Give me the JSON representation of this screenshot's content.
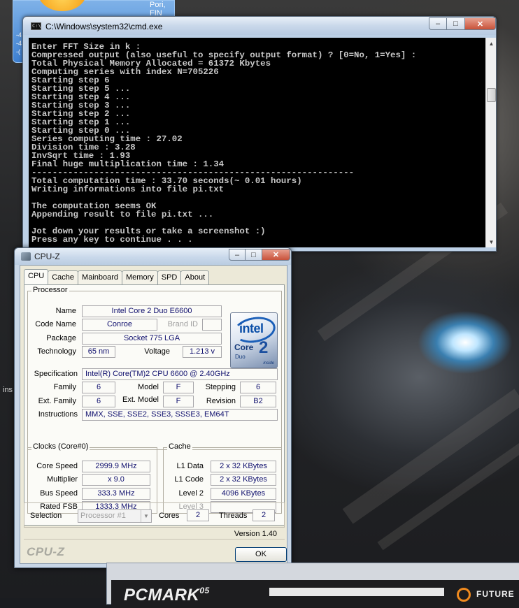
{
  "desktop": {
    "gadget_city": "Pori, FIN",
    "gadget_small": [
      "-4",
      "-4",
      "-("
    ],
    "side_text": "ins"
  },
  "cmd": {
    "title": "C:\\Windows\\system32\\cmd.exe",
    "icon_text": "C:\\",
    "lines": [
      "Enter FFT Size in k :",
      "Compressed output (also useful to specify output format) ? [0=No, 1=Yes] :",
      "Total Physical Memory Allocated = 61372 Kbytes",
      "Computing series with index N=705226",
      "Starting step 6",
      "Starting step 5 ...",
      "Starting step 4 ...",
      "Starting step 3 ...",
      "Starting step 2 ...",
      "Starting step 1 ...",
      "Starting step 0 ...",
      "Series computing time : 27.02",
      "Division time : 3.28",
      "InvSqrt time : 1.93",
      "Final huge multiplication time : 1.34",
      "--------------------------------------------------------------",
      "Total computation time : 33.70 seconds(~ 0.01 hours)",
      "Writing informations into file pi.txt",
      "",
      "The computation seems OK",
      "Appending result to file pi.txt ...",
      "",
      "Jot down your results or take a screenshot :)",
      "Press any key to continue . . ."
    ]
  },
  "cpuz": {
    "title": "CPU-Z",
    "tabs": [
      "CPU",
      "Cache",
      "Mainboard",
      "Memory",
      "SPD",
      "About"
    ],
    "processor": {
      "group_title": "Processor",
      "name_label": "Name",
      "name": "Intel Core 2 Duo E6600",
      "codename_label": "Code Name",
      "codename": "Conroe",
      "brandid_label": "Brand ID",
      "brandid": "",
      "package_label": "Package",
      "package": "Socket 775 LGA",
      "technology_label": "Technology",
      "technology": "65 nm",
      "voltage_label": "Voltage",
      "voltage": "1.213 v",
      "spec_label": "Specification",
      "spec": "Intel(R) Core(TM)2 CPU          6600  @ 2.40GHz",
      "family_label": "Family",
      "family": "6",
      "model_label": "Model",
      "model": "F",
      "stepping_label": "Stepping",
      "stepping": "6",
      "extfamily_label": "Ext. Family",
      "extfamily": "6",
      "extmodel_label": "Ext. Model",
      "extmodel": "F",
      "revision_label": "Revision",
      "revision": "B2",
      "instructions_label": "Instructions",
      "instructions": "MMX, SSE, SSE2, SSE3, SSSE3, EM64T"
    },
    "logo": {
      "word": "intel",
      "core": "Core",
      "two": "2",
      "duo": "Duo",
      "inside": "inside"
    },
    "clocks": {
      "group_title": "Clocks (Core#0)",
      "corespeed_label": "Core Speed",
      "corespeed": "2999.9 MHz",
      "multiplier_label": "Multiplier",
      "multiplier": "x 9.0",
      "busspeed_label": "Bus Speed",
      "busspeed": "333.3 MHz",
      "ratedfsb_label": "Rated FSB",
      "ratedfsb": "1333.3 MHz"
    },
    "cache": {
      "group_title": "Cache",
      "l1data_label": "L1 Data",
      "l1data": "2 x 32 KBytes",
      "l1code_label": "L1 Code",
      "l1code": "2 x 32 KBytes",
      "level2_label": "Level 2",
      "level2": "4096 KBytes",
      "level3_label": "Level 3",
      "level3": ""
    },
    "selection": {
      "selection_label": "Selection",
      "selection_value": "Processor #1",
      "cores_label": "Cores",
      "cores": "2",
      "threads_label": "Threads",
      "threads": "2"
    },
    "version": "Version 1.40",
    "brand": "CPU-Z",
    "ok_label": "OK"
  },
  "pcmark": {
    "logo": "PCMARK",
    "logo_sup": "05",
    "publisher": "FUTURE"
  }
}
